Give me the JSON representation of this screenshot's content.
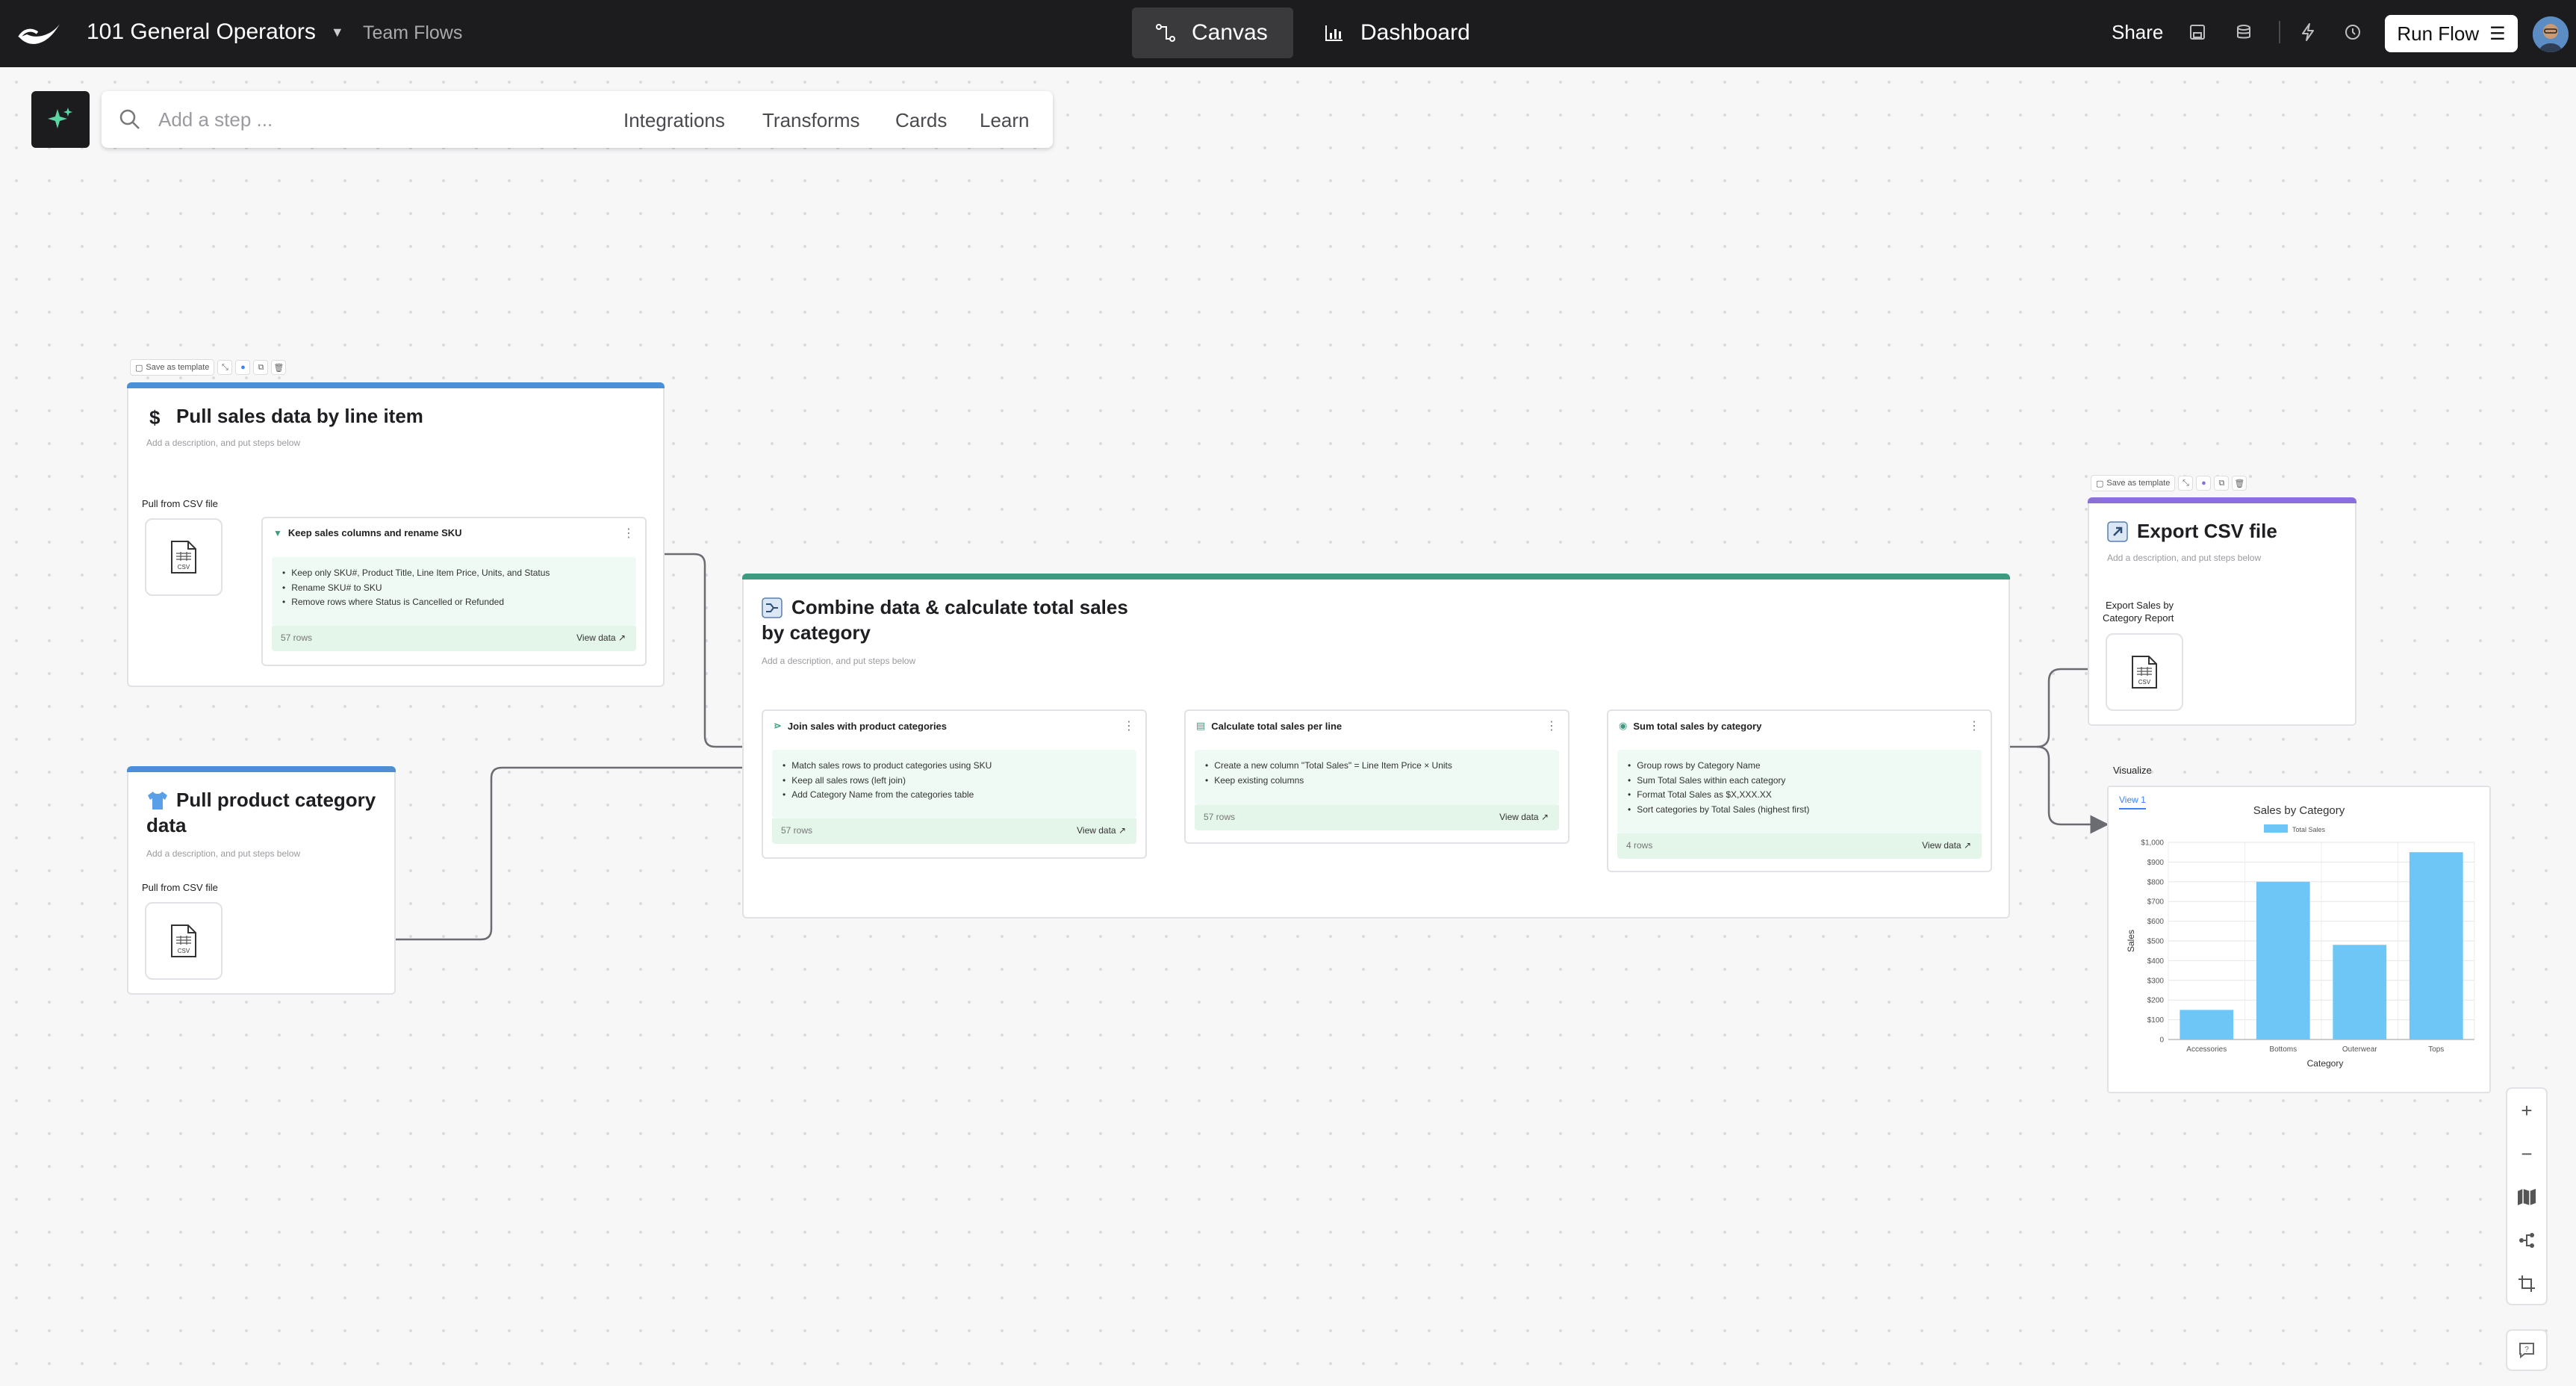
{
  "topbar": {
    "workspace": "101 General Operators",
    "breadcrumb": "Team Flows",
    "tab_canvas": "Canvas",
    "tab_dashboard": "Dashboard",
    "share": "Share",
    "run_flow": "Run Flow"
  },
  "search": {
    "placeholder": "Add a step ...",
    "links": [
      "Integrations",
      "Transforms",
      "Cards",
      "Learn"
    ]
  },
  "template_toolbar": {
    "save_as_template": "Save as template"
  },
  "card_pull_sales": {
    "title": "Pull sales data by line item",
    "description": "Add a description, and put steps below",
    "source_label": "Pull from CSV file",
    "step": {
      "title": "Keep sales columns and rename SKU",
      "bullets": [
        "Keep only SKU#, Product Title, Line Item Price, Units, and Status",
        "Rename SKU# to SKU",
        "Remove rows where Status is Cancelled or Refunded"
      ],
      "rows": "57 rows",
      "view_data": "View data"
    }
  },
  "card_pull_category": {
    "title_line1": "Pull product category",
    "title_line2": "data",
    "description": "Add a description, and put steps below",
    "source_label": "Pull from CSV file"
  },
  "card_combine": {
    "title_line1": "Combine data & calculate total sales",
    "title_line2": "by category",
    "description": "Add a description, and put steps below",
    "steps": [
      {
        "title": "Join sales with product categories",
        "bullets": [
          "Match sales rows to product categories using SKU",
          "Keep all sales rows (left join)",
          "Add Category Name from the categories table"
        ],
        "rows": "57 rows",
        "view_data": "View data"
      },
      {
        "title": "Calculate total sales per line",
        "bullets": [
          "Create a new column \"Total Sales\" = Line Item Price × Units",
          "Keep existing columns"
        ],
        "rows": "57 rows",
        "view_data": "View data"
      },
      {
        "title": "Sum total sales by category",
        "bullets": [
          "Group rows by Category Name",
          "Sum Total Sales within each category",
          "Format Total Sales as $X,XXX.XX",
          "Sort categories by Total Sales (highest first)"
        ],
        "rows": "4 rows",
        "view_data": "View data"
      }
    ]
  },
  "card_export": {
    "title": "Export CSV file",
    "description": "Add a description, and put steps below",
    "source_label_line1": "Export Sales by",
    "source_label_line2": "Category Report"
  },
  "csv_label": "CSV",
  "visualize": {
    "label": "Visualize",
    "tab": "View 1"
  },
  "chart_data": {
    "type": "bar",
    "title": "Sales by Category",
    "xlabel": "Category",
    "ylabel": "Sales",
    "categories": [
      "Accessories",
      "Bottoms",
      "Outerwear",
      "Tops"
    ],
    "series": [
      {
        "name": "Total Sales",
        "values": [
          150,
          800,
          480,
          950
        ],
        "color": "#6ec6f6"
      }
    ],
    "ylim": [
      0,
      1000
    ],
    "yticks": [
      "0",
      "$100",
      "$200",
      "$300",
      "$400",
      "$500",
      "$600",
      "$700",
      "$800",
      "$900",
      "$1,000"
    ],
    "grid": true,
    "legend": "top"
  },
  "colors": {
    "pull_sales_accent": "#4a90d9",
    "pull_category_accent": "#4a90d9",
    "combine_accent": "#3d9b7f",
    "export_accent": "#8b6fdc",
    "step_body": "#eefaf3"
  },
  "icons": {
    "ai": "sparkle-icon",
    "search": "search-icon",
    "csv": "csv-file-icon"
  }
}
